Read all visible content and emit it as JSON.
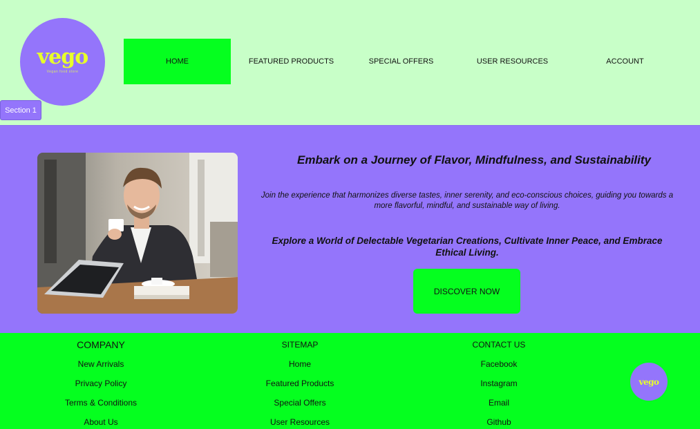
{
  "logo": {
    "word": "vego",
    "tagline": "Vegan food store"
  },
  "nav": {
    "items": [
      {
        "label": "HOME"
      },
      {
        "label": "FEATURED PRODUCTS"
      },
      {
        "label": "SPECIAL OFFERS"
      },
      {
        "label": "USER RESOURCES"
      },
      {
        "label": "ACCOUNT"
      }
    ]
  },
  "section_badge": "Section 1",
  "hero": {
    "title": "Embark on a Journey of Flavor, Mindfulness, and Sustainability",
    "description": "Join the experience that harmonizes diverse tastes, inner serenity, and eco-conscious choices, guiding you towards a more flavorful, mindful, and sustainable way of living.",
    "subtitle": "Explore a World of Delectable Vegetarian Creations, Cultivate Inner Peace, and Embrace Ethical Living.",
    "cta": "DISCOVER NOW"
  },
  "footer": {
    "company": {
      "heading": "COMPANY",
      "links": [
        "New Arrivals",
        "Privacy Policy",
        "Terms & Conditions",
        "About Us"
      ]
    },
    "sitemap": {
      "heading": "SITEMAP",
      "links": [
        "Home",
        "Featured Products",
        "Special Offers",
        "User Resources"
      ]
    },
    "contact": {
      "heading": "CONTACT US",
      "links": [
        "Facebook",
        "Instagram",
        "Email",
        "Github"
      ]
    },
    "logo_word": "vego"
  },
  "colors": {
    "page_bg": "#c8ffc8",
    "accent_purple": "#9475fb",
    "accent_green": "#05ff1f",
    "logo_yellow": "#e8ff2a"
  }
}
